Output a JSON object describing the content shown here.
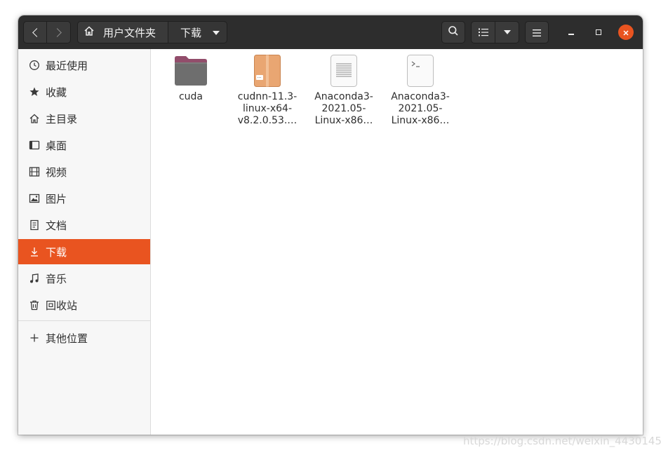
{
  "header": {
    "path_home_label": "用户文件夹",
    "path_current_label": "下载"
  },
  "sidebar": {
    "items": [
      {
        "label": "最近使用",
        "icon": "clock-icon"
      },
      {
        "label": "收藏",
        "icon": "star-icon"
      },
      {
        "label": "主目录",
        "icon": "home-icon"
      },
      {
        "label": "桌面",
        "icon": "desktop-icon"
      },
      {
        "label": "视频",
        "icon": "film-icon"
      },
      {
        "label": "图片",
        "icon": "image-icon"
      },
      {
        "label": "文档",
        "icon": "document-icon"
      },
      {
        "label": "下载",
        "icon": "download-icon",
        "active": true
      },
      {
        "label": "音乐",
        "icon": "music-icon"
      },
      {
        "label": "回收站",
        "icon": "trash-icon"
      }
    ],
    "other_locations_label": "其他位置"
  },
  "files": [
    {
      "name": "cuda",
      "type": "folder"
    },
    {
      "name": "cudnn-11.3-\nlinux-x64-\nv8.2.0.53.…",
      "type": "archive"
    },
    {
      "name": "Anaconda3-\n2021.05-\nLinux-x86…",
      "type": "text-file"
    },
    {
      "name": "Anaconda3-\n2021.05-\nLinux-x86…",
      "type": "script-file"
    }
  ],
  "watermark": "https://blog.csdn.net/weixin_4430145",
  "colors": {
    "accent": "#e95420",
    "headerbar": "#2d2d2d",
    "folder": "#6e6e6e",
    "folder_tab": "#924d6b",
    "archive": "#e9a672"
  }
}
